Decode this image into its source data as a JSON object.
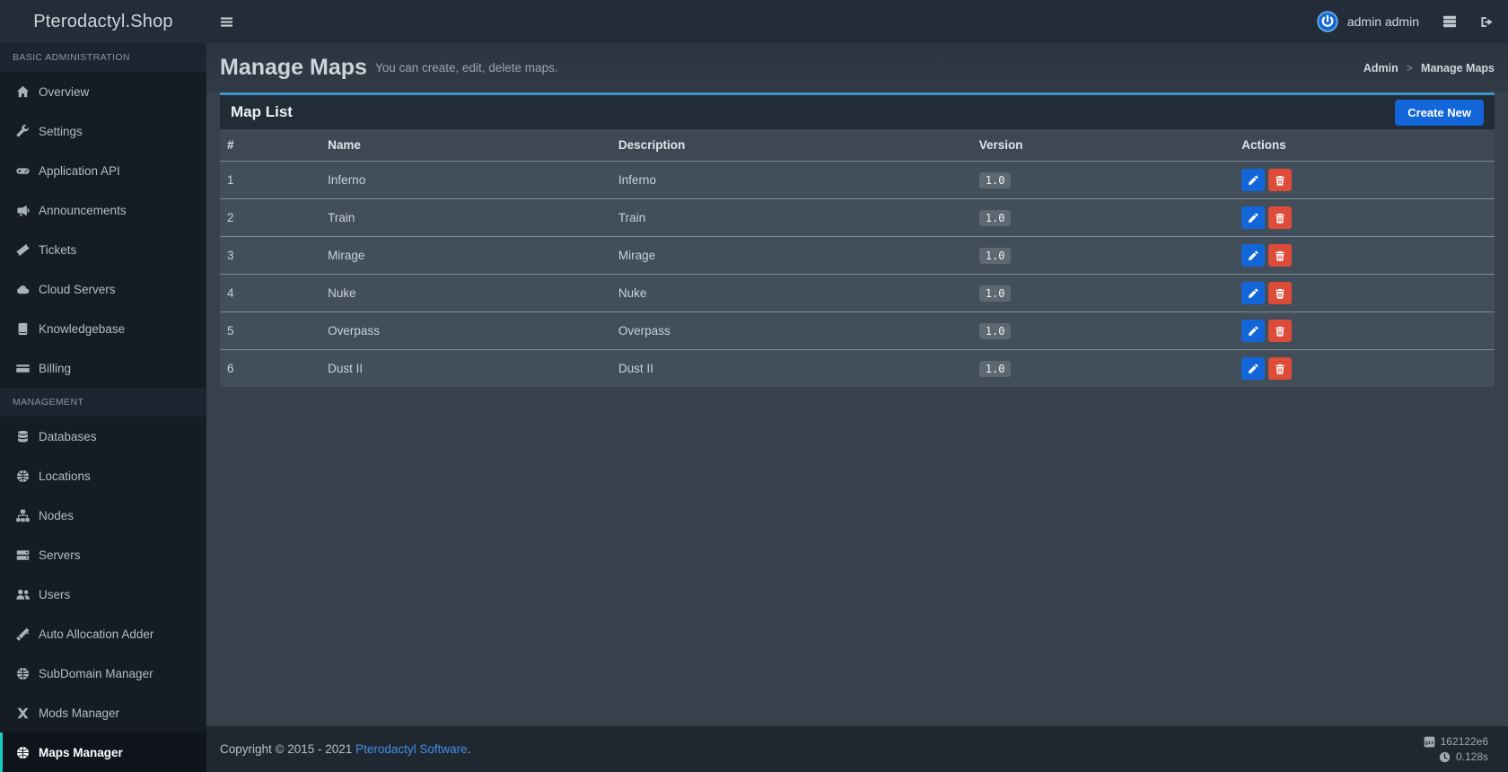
{
  "app": {
    "title": "Pterodactyl.Shop"
  },
  "navbar": {
    "menu_icon": "hamburger-icon",
    "user": {
      "name": "admin admin",
      "avatar_icon": "power-avatar-icon"
    },
    "action_icons": [
      {
        "icon": "server-stack-icon"
      },
      {
        "icon": "sign-out-icon"
      }
    ]
  },
  "sidebar": {
    "sections": [
      {
        "header": "BASIC ADMINISTRATION",
        "items": [
          {
            "label": "Overview",
            "icon": "home-icon",
            "active": false
          },
          {
            "label": "Settings",
            "icon": "wrench-icon",
            "active": false
          },
          {
            "label": "Application API",
            "icon": "gamepad-icon",
            "active": false
          },
          {
            "label": "Announcements",
            "icon": "bullhorn-icon",
            "active": false
          },
          {
            "label": "Tickets",
            "icon": "ticket-icon",
            "active": false
          },
          {
            "label": "Cloud Servers",
            "icon": "cloud-icon",
            "active": false
          },
          {
            "label": "Knowledgebase",
            "icon": "book-icon",
            "active": false
          },
          {
            "label": "Billing",
            "icon": "credit-card-icon",
            "active": false
          }
        ]
      },
      {
        "header": "MANAGEMENT",
        "items": [
          {
            "label": "Databases",
            "icon": "database-icon",
            "active": false
          },
          {
            "label": "Locations",
            "icon": "globe-icon",
            "active": false
          },
          {
            "label": "Nodes",
            "icon": "sitemap-icon",
            "active": false
          },
          {
            "label": "Servers",
            "icon": "server-icon",
            "active": false
          },
          {
            "label": "Users",
            "icon": "users-icon",
            "active": false
          },
          {
            "label": "Auto Allocation Adder",
            "icon": "magic-icon",
            "active": false
          },
          {
            "label": "SubDomain Manager",
            "icon": "globe-icon",
            "active": false
          },
          {
            "label": "Mods Manager",
            "icon": "mods-icon",
            "active": false
          },
          {
            "label": "Maps Manager",
            "icon": "globe-icon",
            "active": true
          }
        ]
      }
    ]
  },
  "content": {
    "header": {
      "title": "Manage Maps",
      "subtitle": "You can create, edit, delete maps.",
      "breadcrumb_separator": ">",
      "breadcrumb": [
        {
          "label": "Admin",
          "link": true
        },
        {
          "label": "Manage Maps",
          "link": false
        }
      ]
    },
    "panel": {
      "title": "Map List",
      "create_button_label": "Create New",
      "table": {
        "columns": [
          "#",
          "Name",
          "Description",
          "Version",
          "Actions"
        ],
        "column_widths": [
          "7.9%",
          "22.8%",
          "28.3%",
          "20.6%",
          "20.4%"
        ],
        "rows": [
          {
            "id": "1",
            "name": "Inferno",
            "description": "Inferno",
            "version": "1.0"
          },
          {
            "id": "2",
            "name": "Train",
            "description": "Train",
            "version": "1.0"
          },
          {
            "id": "3",
            "name": "Mirage",
            "description": "Mirage",
            "version": "1.0"
          },
          {
            "id": "4",
            "name": "Nuke",
            "description": "Nuke",
            "version": "1.0"
          },
          {
            "id": "5",
            "name": "Overpass",
            "description": "Overpass",
            "version": "1.0"
          },
          {
            "id": "6",
            "name": "Dust II",
            "description": "Dust II",
            "version": "1.0"
          }
        ],
        "row_actions": [
          {
            "type": "edit",
            "icon": "pencil-icon"
          },
          {
            "type": "delete",
            "icon": "trash-icon"
          }
        ]
      }
    }
  },
  "footer": {
    "copyright_prefix": "Copyright © 2015 - 2021",
    "link_label": "Pterodactyl Software",
    "copyright_suffix": ".",
    "build": {
      "icon": "git-icon",
      "value": "162122e6"
    },
    "timing": {
      "icon": "clock-icon",
      "value": "0.128s"
    }
  },
  "colors": {
    "accent_blue": "#1266d9",
    "danger_red": "#dd4b39",
    "panel_border_blue": "#4193c7",
    "active_item_teal": "#12cfc0",
    "link_blue": "#4191e2"
  }
}
